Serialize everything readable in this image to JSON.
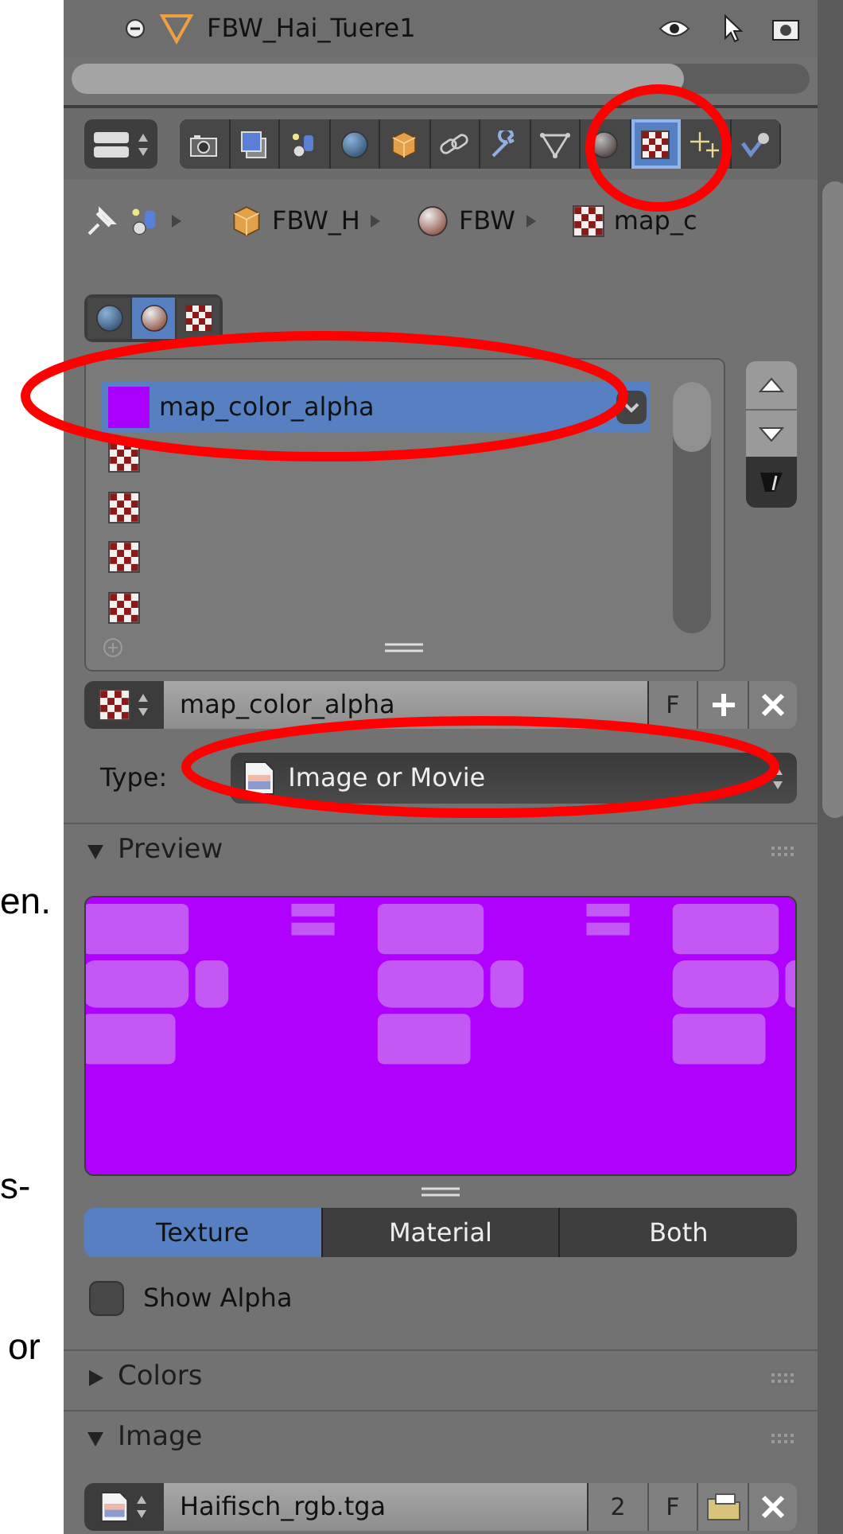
{
  "background_text": [
    "en.",
    "s-",
    "or"
  ],
  "outliner": {
    "object_name": "FBW_Hai_Tuere1"
  },
  "property_tabs": [
    {
      "selected": false
    },
    {
      "selected": false
    },
    {
      "selected": false
    },
    {
      "selected": false
    },
    {
      "selected": false
    },
    {
      "selected": false
    },
    {
      "selected": false
    },
    {
      "selected": false
    },
    {
      "selected": false
    },
    {
      "selected": true
    },
    {
      "selected": false
    },
    {
      "selected": false
    }
  ],
  "breadcrumb": [
    "FBW_H",
    "FBW",
    "map_c"
  ],
  "context_tabs": [
    {
      "selected": false
    },
    {
      "selected": true
    },
    {
      "selected": false
    }
  ],
  "texture_slots": [
    {
      "label": "map_color_alpha",
      "selected": true,
      "color": "#aa00ff"
    },
    {
      "selected": false
    },
    {
      "selected": false
    },
    {
      "selected": false
    },
    {
      "selected": false
    }
  ],
  "texture_field": {
    "value": "map_color_alpha",
    "fake_user": "F"
  },
  "type": {
    "label": "Type:",
    "value": "Image or Movie"
  },
  "preview": {
    "title": "Preview",
    "expanded": true,
    "tabs": [
      {
        "label": "Texture",
        "selected": true
      },
      {
        "label": "Material",
        "selected": false
      },
      {
        "label": "Both",
        "selected": false
      }
    ],
    "show_alpha": {
      "label": "Show Alpha",
      "checked": false
    }
  },
  "colors_panel": {
    "title": "Colors",
    "expanded": false
  },
  "image_panel": {
    "title": "Image",
    "expanded": true,
    "file": "Haifisch_rgb.tga",
    "users": "2",
    "fake_user": "F"
  }
}
